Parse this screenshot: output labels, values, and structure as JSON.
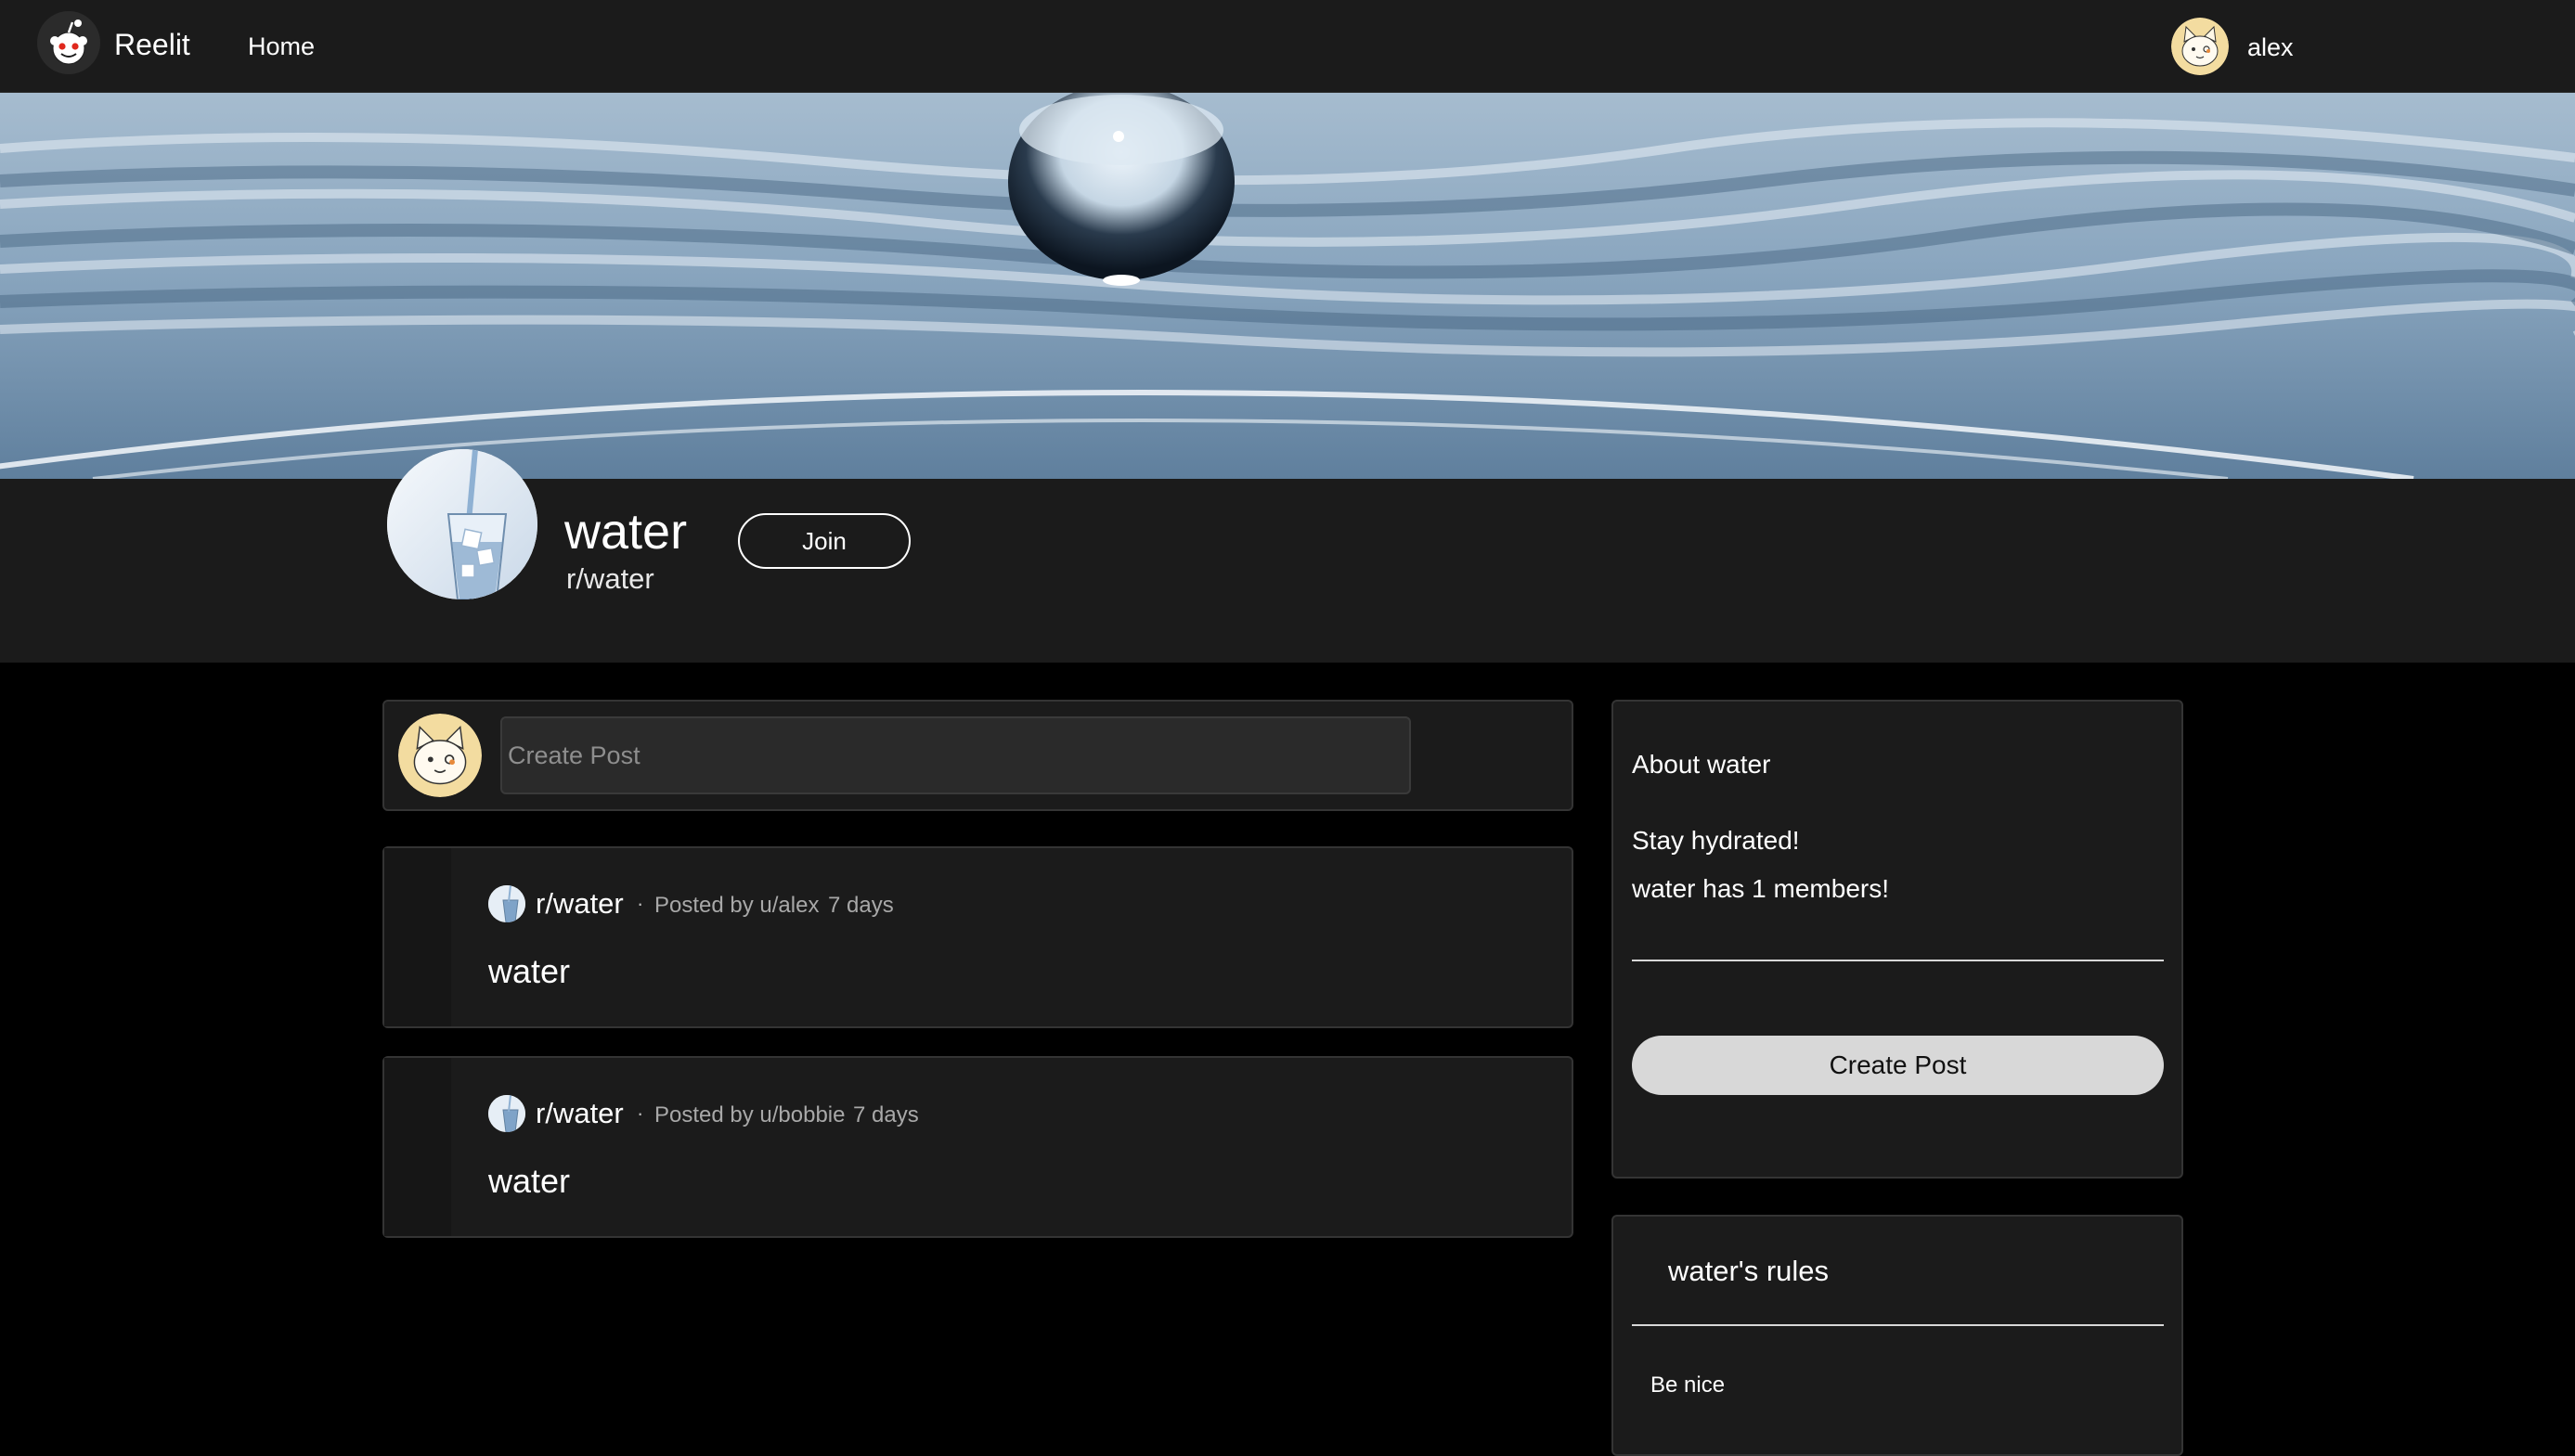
{
  "nav": {
    "brand": "Reelit",
    "home_label": "Home",
    "username": "alex",
    "logo_icon": "reddit-alien-icon",
    "avatar_icon": "cat-avatar-icon"
  },
  "community": {
    "title": "water",
    "slug": "r/water",
    "join_label": "Join",
    "banner_icon": "water-drop-banner",
    "community_icon": "water-glass-icon"
  },
  "create_post": {
    "placeholder": "Create Post"
  },
  "posts": [
    {
      "subreddit": "r/water",
      "dot": "·",
      "author": "Posted by u/alex",
      "time": "7 days",
      "title": "water"
    },
    {
      "subreddit": "r/water",
      "dot": "·",
      "author": "Posted by u/bobbie",
      "time": "7 days",
      "title": "water"
    }
  ],
  "about": {
    "title": "About water",
    "description": "Stay hydrated!",
    "members": "water has 1 members!",
    "create_post_label": "Create Post"
  },
  "rules": {
    "title": "water's rules",
    "items": [
      "Be nice"
    ]
  },
  "colors": {
    "nav_bg": "#1b1b1b",
    "page_bg": "#000000",
    "card_bg": "#1b1b1b",
    "button_light": "#d8d8d8"
  }
}
